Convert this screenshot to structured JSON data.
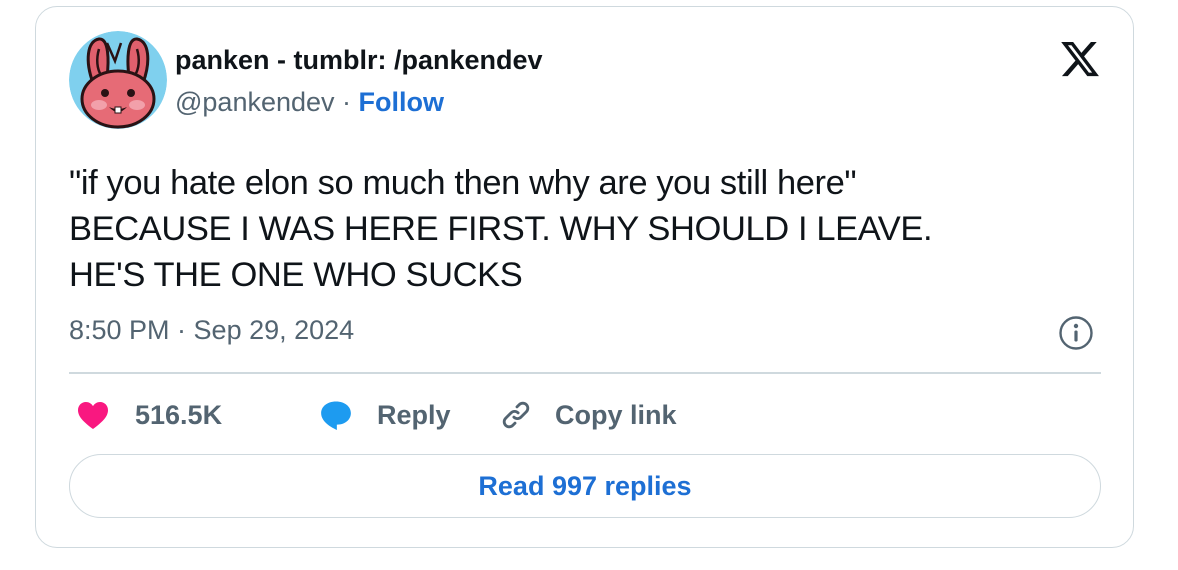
{
  "author": {
    "display_name": "panken - tumblr: /pankendev",
    "handle": "@pankendev",
    "separator": " · ",
    "follow_label": "Follow",
    "avatar_icon": "pink-bunny-avatar"
  },
  "brand": {
    "logo_icon": "x-logo-icon"
  },
  "tweet": {
    "lines": [
      "\"if you hate elon so much then why are you still here\"",
      "BECAUSE I WAS HERE FIRST. WHY SHOULD I LEAVE.",
      "HE'S THE ONE WHO SUCKS"
    ],
    "timestamp": "8:50 PM · Sep 29, 2024"
  },
  "actions": {
    "like_count": "516.5K",
    "reply_label": "Reply",
    "copy_link_label": "Copy link"
  },
  "read_replies_label": "Read 997 replies",
  "colors": {
    "like": "#f91880",
    "reply": "#1d9bf0",
    "link": "#1d6fd4",
    "muted": "#536471",
    "border": "#cfd9de"
  }
}
